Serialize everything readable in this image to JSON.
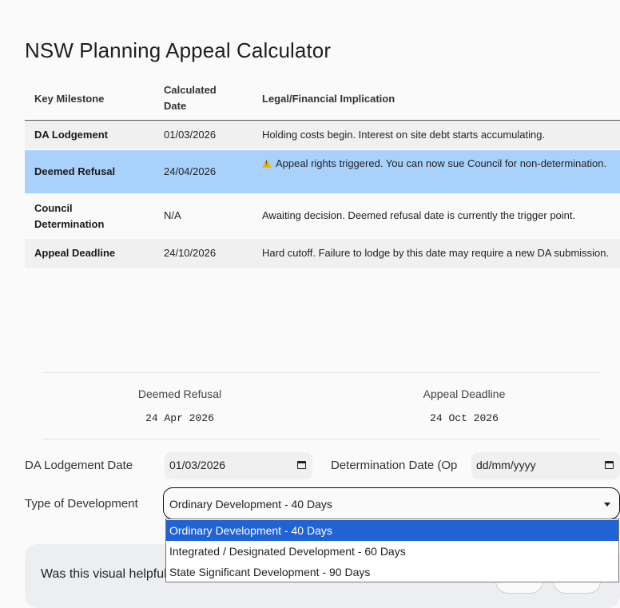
{
  "title": "NSW Planning Appeal Calculator",
  "table": {
    "headers": [
      "Key Milestone",
      "Calculated Date",
      "Legal/Financial Implication"
    ],
    "rows": [
      {
        "milestone": "DA Lodgement",
        "date": "01/03/2026",
        "implication": "Holding costs begin. Interest on site debt starts accumulating.",
        "highlight": false,
        "warning": false
      },
      {
        "milestone": "Deemed Refusal",
        "date": "24/04/2026",
        "implication": "Appeal rights triggered. You can now sue Council for non-determination.",
        "highlight": true,
        "warning": true
      },
      {
        "milestone": "Council Determination",
        "date": "N/A",
        "implication": "Awaiting decision. Deemed refusal date is currently the trigger point.",
        "highlight": false,
        "warning": false
      },
      {
        "milestone": "Appeal Deadline",
        "date": "24/10/2026",
        "implication": "Hard cutoff. Failure to lodge by this date may require a new DA submission.",
        "highlight": false,
        "warning": false
      }
    ]
  },
  "summary": {
    "deemed_label": "Deemed Refusal",
    "deemed_value": "24 Apr 2026",
    "appeal_label": "Appeal Deadline",
    "appeal_value": "24 Oct 2026"
  },
  "form": {
    "lodgement_label": "DA Lodgement Date",
    "lodgement_value": "01/03/2026",
    "determination_label": "Determination Date (Op",
    "determination_placeholder": "dd/mm/yyyy",
    "development_label": "Type of Development",
    "development_value": "Ordinary Development - 40 Days",
    "development_options": [
      "Ordinary Development - 40 Days",
      "Integrated / Designated Development - 60 Days",
      "State Significant Development - 90 Days"
    ]
  },
  "feedback": {
    "question": "Was this visual helpful"
  },
  "colors": {
    "highlight_row": "#a8d1fb",
    "selected_option": "#2163d4",
    "warning": "#f2b500"
  }
}
